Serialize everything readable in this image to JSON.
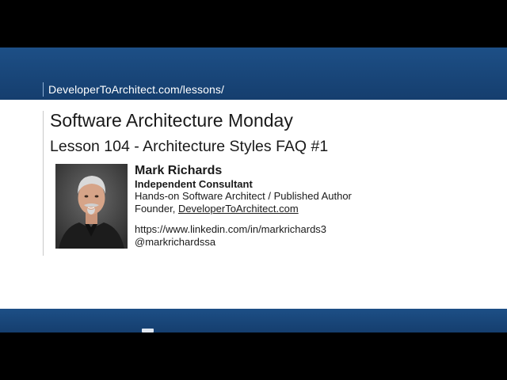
{
  "header": {
    "site_url": "DeveloperToArchitect.com/lessons/"
  },
  "main": {
    "title": "Software Architecture Monday",
    "subtitle": "Lesson 104 - Architecture Styles FAQ #1"
  },
  "presenter": {
    "name": "Mark Richards",
    "role": "Independent Consultant",
    "description": "Hands-on Software Architect / Published Author",
    "founder_prefix": "Founder, ",
    "founder_link": "DeveloperToArchitect.com",
    "linkedin": "https://www.linkedin.com/in/markrichards3",
    "twitter": "@markrichardssa"
  },
  "colors": {
    "band": "#1a4a80",
    "background": "#ffffff",
    "letterbox": "#000000"
  }
}
